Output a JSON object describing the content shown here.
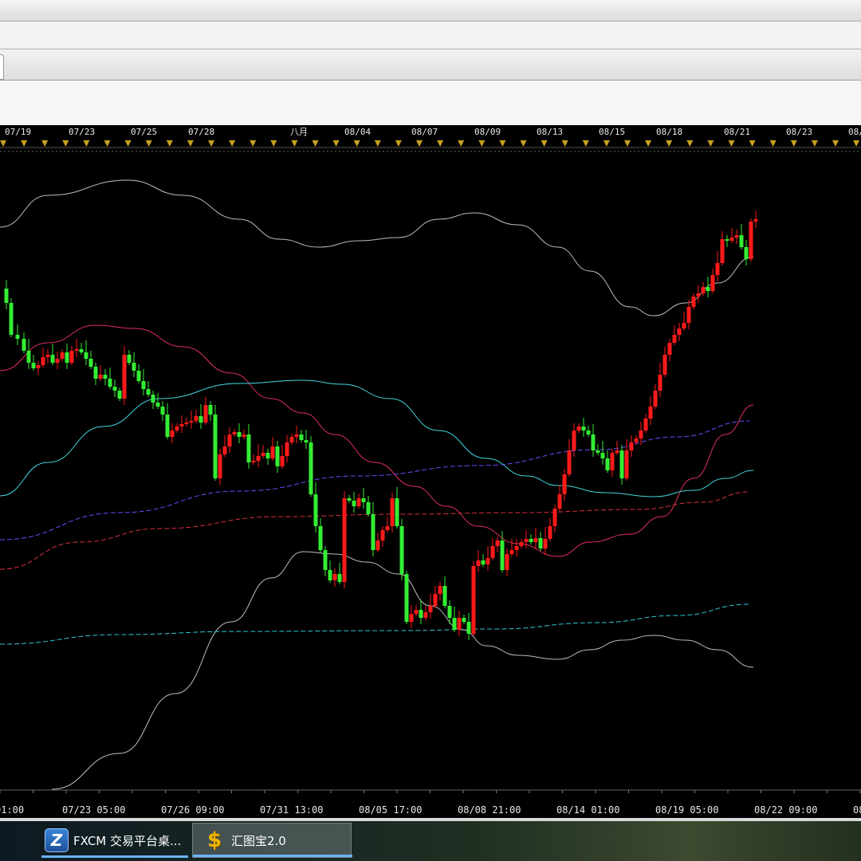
{
  "chart_data": {
    "type": "candlestick",
    "top_axis_labels": [
      "07/19",
      "07/23",
      "07/25",
      "07/28",
      "八月",
      "08/04",
      "08/07",
      "08/09",
      "08/13",
      "08/15",
      "08/18",
      "08/21",
      "08/23",
      "08/"
    ],
    "bottom_axis_labels": [
      "01:00",
      "07/23 05:00",
      "07/26 09:00",
      "07/31 13:00",
      "08/05 17:00",
      "08/08 21:00",
      "08/14 01:00",
      "08/19 05:00",
      "08/22 09:00",
      "08/"
    ],
    "colors": {
      "up": "#ff1a1a",
      "down": "#33ee33",
      "background": "#000000",
      "bollinger": "#bdbdbd",
      "ma_red": "#e0305a",
      "ma_cyan": "#40d8e0",
      "ma_purple": "#6a4cff",
      "ma_red_dash": "#d83040",
      "ma_cyan_dash": "#30c8d8",
      "tick_marker": "#c8a020"
    },
    "grid": false
  },
  "taskbar": {
    "items": [
      {
        "label": "FXCM 交易平台桌...",
        "icon": "fxcm-logo-icon"
      },
      {
        "label": "汇图宝2.0",
        "icon": "dollar-icon"
      }
    ]
  }
}
